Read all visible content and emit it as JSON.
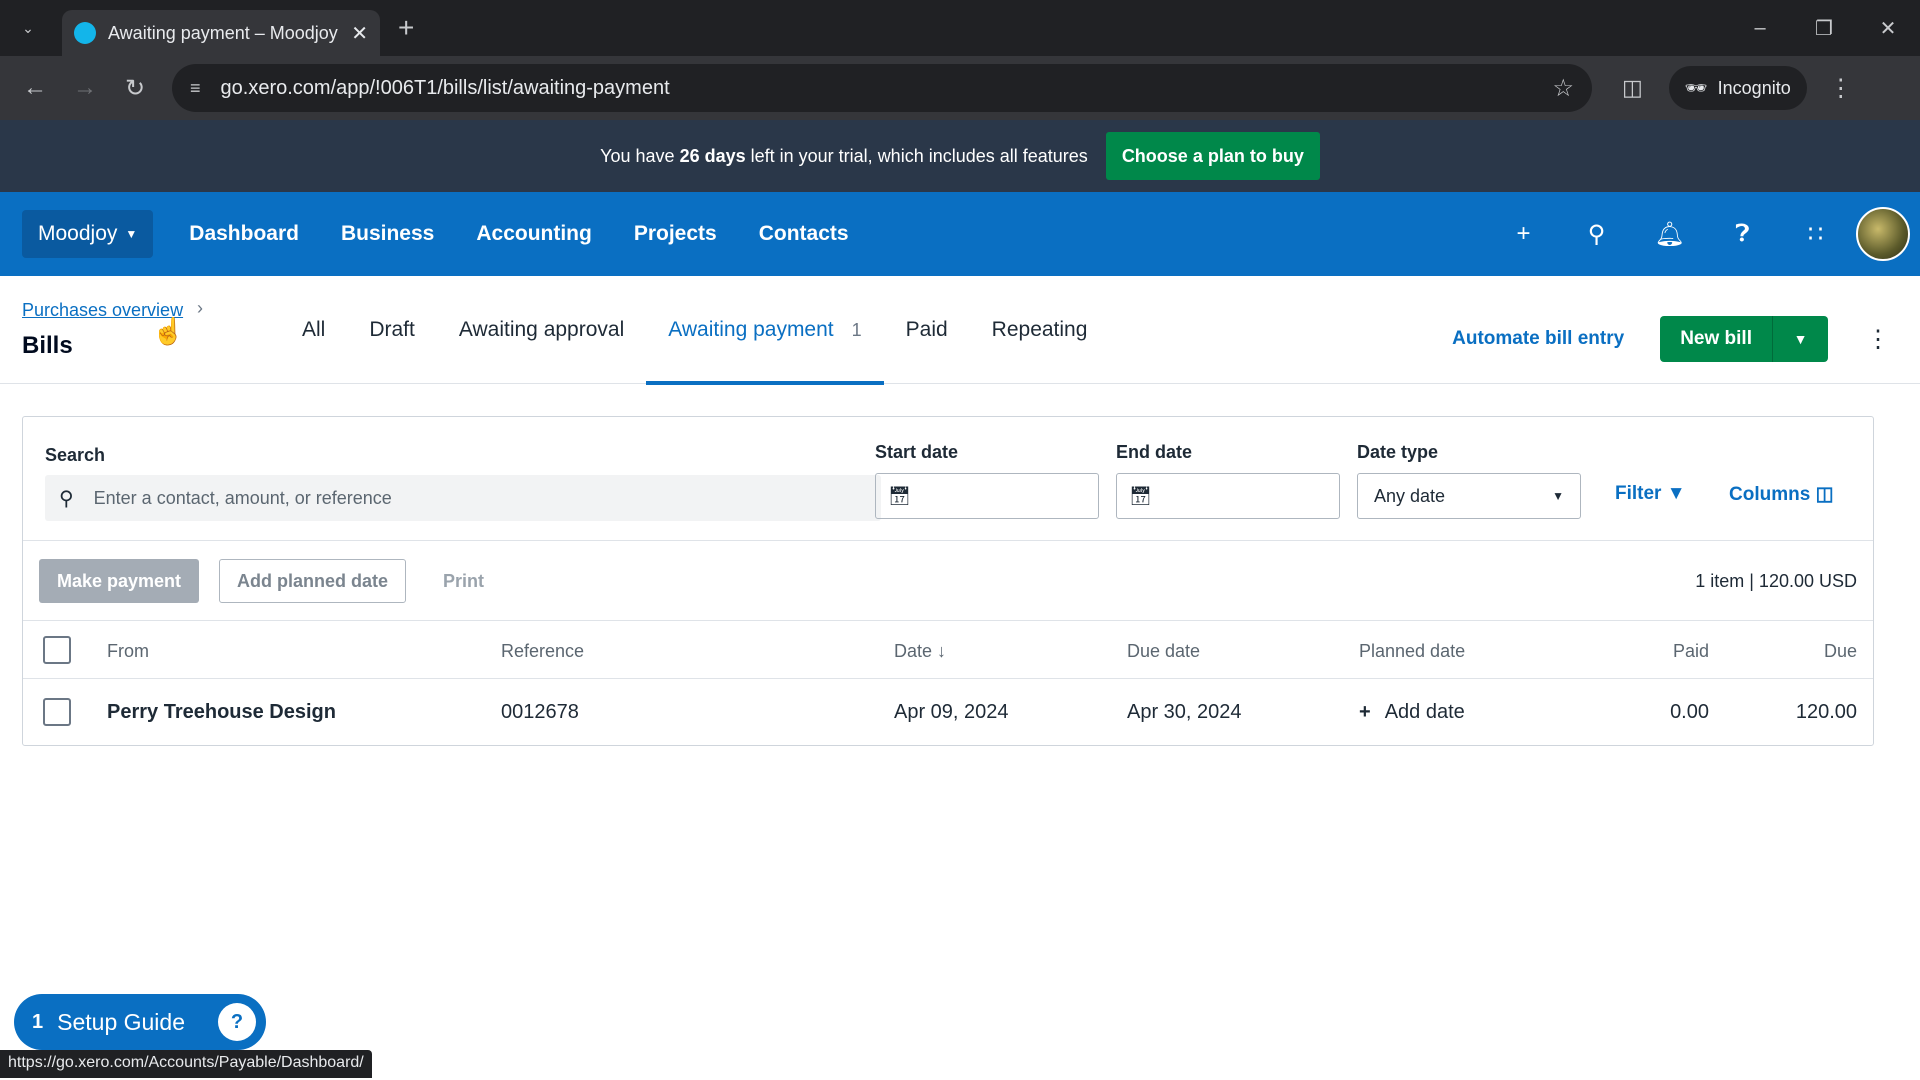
{
  "browser": {
    "tab_title": "Awaiting payment – Moodjoy –",
    "url": "go.xero.com/app/!006T1/bills/list/awaiting-payment",
    "incognito_label": "Incognito",
    "status_url": "https://go.xero.com/Accounts/Payable/Dashboard/"
  },
  "trial": {
    "prefix": "You have ",
    "days": "26 days",
    "suffix": " left in your trial, which includes all features",
    "button": "Choose a plan to buy"
  },
  "nav": {
    "org": "Moodjoy",
    "links": [
      "Dashboard",
      "Business",
      "Accounting",
      "Projects",
      "Contacts"
    ]
  },
  "page": {
    "breadcrumb": "Purchases overview",
    "title": "Bills",
    "tabs": [
      {
        "label": "All"
      },
      {
        "label": "Draft"
      },
      {
        "label": "Awaiting approval"
      },
      {
        "label": "Awaiting payment",
        "count": "1"
      },
      {
        "label": "Paid"
      },
      {
        "label": "Repeating"
      }
    ],
    "automate": "Automate bill entry",
    "new_bill": "New bill"
  },
  "filters": {
    "search_label": "Search",
    "search_placeholder": "Enter a contact, amount, or reference",
    "start_date_label": "Start date",
    "end_date_label": "End date",
    "date_type_label": "Date type",
    "date_type_value": "Any date",
    "filter": "Filter",
    "columns": "Columns"
  },
  "actions": {
    "make_payment": "Make payment",
    "add_planned_date": "Add planned date",
    "print": "Print",
    "summary": "1 item | 120.00 USD"
  },
  "table": {
    "headers": {
      "from": "From",
      "reference": "Reference",
      "date": "Date",
      "due_date": "Due date",
      "planned_date": "Planned date",
      "paid": "Paid",
      "due": "Due"
    },
    "rows": [
      {
        "from": "Perry Treehouse Design",
        "reference": "0012678",
        "date": "Apr 09, 2024",
        "due_date": "Apr 30, 2024",
        "planned_date": "Add date",
        "paid": "0.00",
        "due": "120.00"
      }
    ]
  },
  "setup_guide": {
    "count": "1",
    "label": "Setup Guide"
  }
}
